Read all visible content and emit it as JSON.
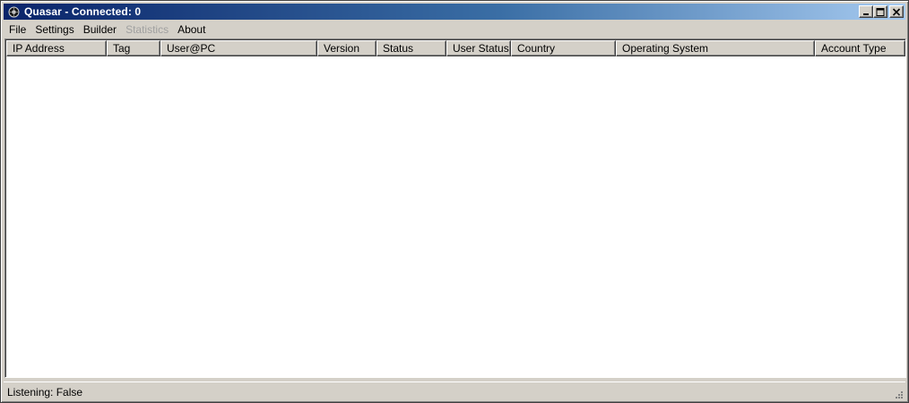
{
  "window": {
    "title": "Quasar - Connected: 0",
    "icon": "quasar-app-icon"
  },
  "menu": [
    {
      "label": "File",
      "enabled": true
    },
    {
      "label": "Settings",
      "enabled": true
    },
    {
      "label": "Builder",
      "enabled": true
    },
    {
      "label": "Statistics",
      "enabled": false
    },
    {
      "label": "About",
      "enabled": true
    }
  ],
  "list": {
    "columns": [
      {
        "label": "IP Address"
      },
      {
        "label": "Tag"
      },
      {
        "label": "User@PC"
      },
      {
        "label": "Version"
      },
      {
        "label": "Status"
      },
      {
        "label": "User Status"
      },
      {
        "label": "Country"
      },
      {
        "label": "Operating System"
      },
      {
        "label": "Account Type"
      }
    ],
    "rows": []
  },
  "status": {
    "text": "Listening: False"
  },
  "colors": {
    "title_gradient_start": "#0a246a",
    "title_gradient_end": "#a6caf0",
    "face": "#d4d0c8",
    "disabled_text": "#a0a0a0"
  }
}
